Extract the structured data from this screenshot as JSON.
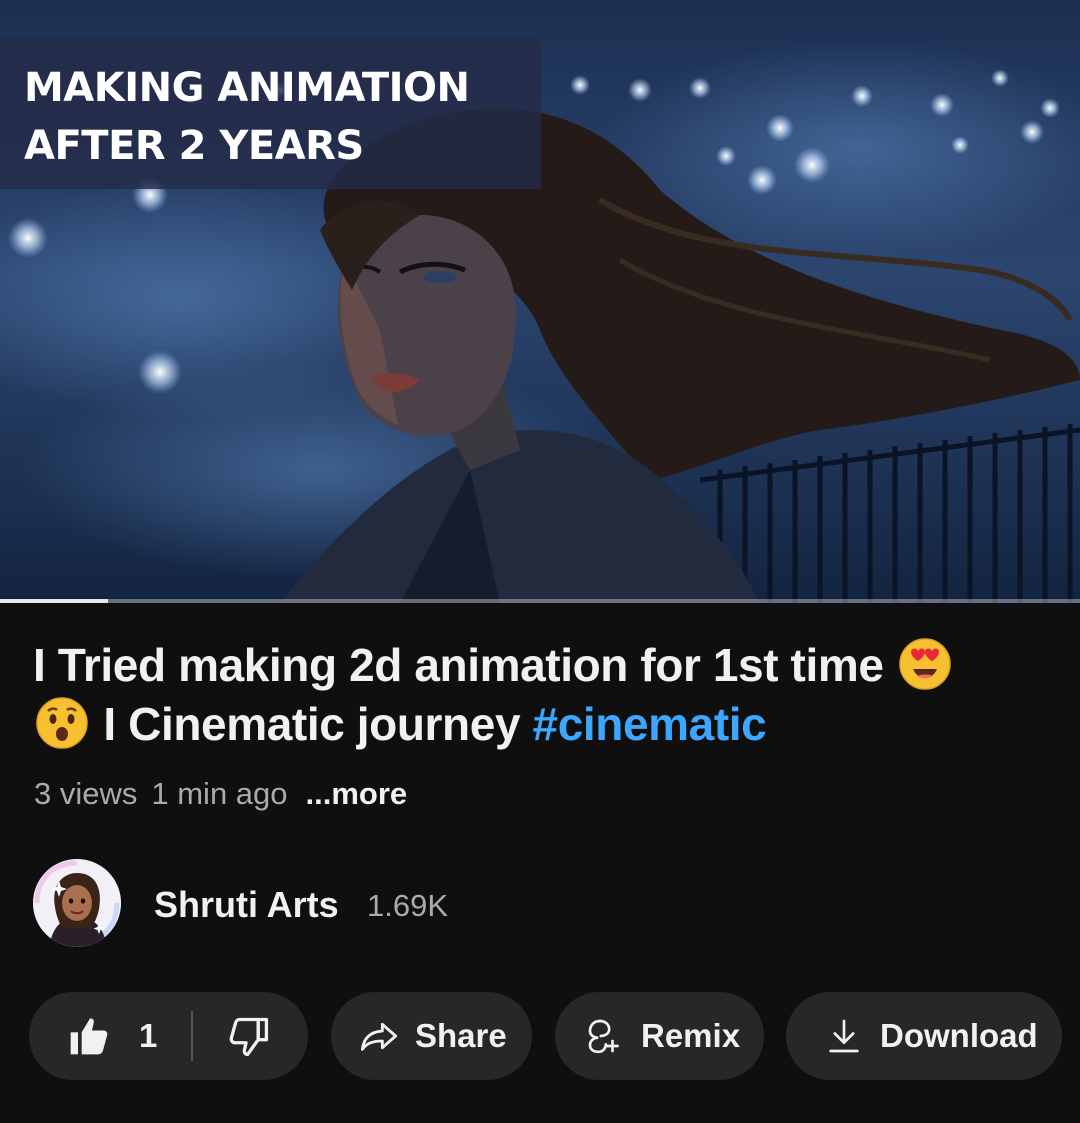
{
  "player": {
    "thumbnail_text_line1": "MAKING ANIMATION",
    "thumbnail_text_line2": "AFTER 2 YEARS",
    "progress": 0.1
  },
  "video": {
    "title_line1": "I Tried making 2d animation for 1st time",
    "title_emoji1": "smiling-face-with-heart-eyes",
    "title_emoji2": "hushed-face",
    "title_line2": "I Cinematic journey",
    "hashtag": "#cinematic",
    "views": "3 views",
    "time_ago": "1 min ago",
    "more_label": "...more"
  },
  "channel": {
    "name": "Shruti Arts",
    "subscribers": "1.69K"
  },
  "actions": {
    "like_count": "1",
    "share_label": "Share",
    "remix_label": "Remix",
    "download_label": "Download"
  },
  "colors": {
    "background": "#0f0f0f",
    "pill": "#272727",
    "hashtag": "#3ea6ff",
    "secondary_text": "#aaaaaa"
  }
}
